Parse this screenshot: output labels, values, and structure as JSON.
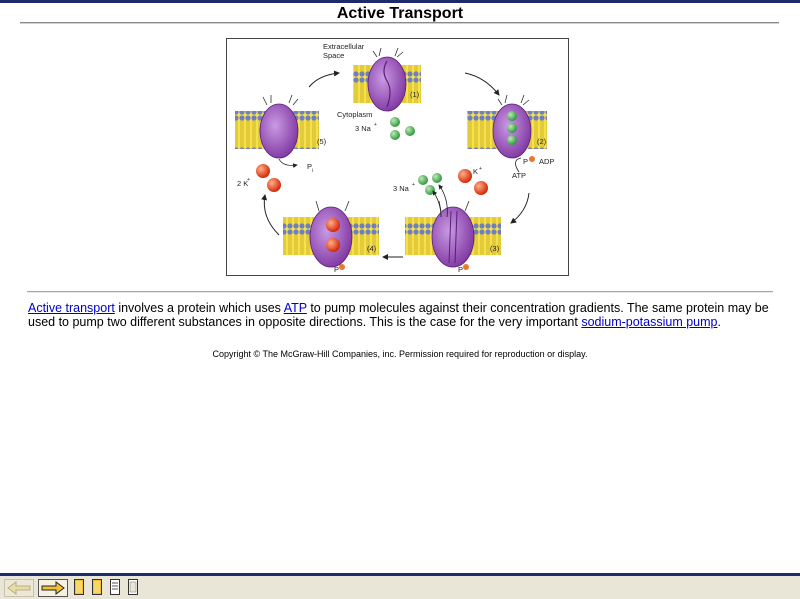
{
  "page": {
    "title": "Active Transport"
  },
  "figure": {
    "labels": {
      "extracellular_line1": "Extracellular",
      "extracellular_line2": "Space",
      "cytoplasm": "Cytoplasm",
      "step1_na": "3 Na",
      "adp": "ADP",
      "p_upper": "P",
      "atp": "ATP",
      "k_upper": "K",
      "step3_na": "3 Na",
      "p_step3": "P",
      "p_step4": "P",
      "two_k": "2 K",
      "pi": "P",
      "pi_sub": "i",
      "plus": "+"
    },
    "steps": [
      "(1)",
      "(2)",
      "(3)",
      "(4)",
      "(5)"
    ],
    "colors": {
      "protein": "#8a3fae",
      "protein_light": "#b77ad6",
      "membrane_yellow": "#f5e24a",
      "lipid_head": "#6f7fbf",
      "sodium": "#2f9a3f",
      "potassium": "#e23a12",
      "phosphate": "#e87a2a"
    }
  },
  "text": {
    "link_active_transport": "Active transport",
    "seg1": " involves a protein which uses ",
    "link_atp": "ATP",
    "seg2": " to pump molecules against their concentration gradients. The same protein may be used to pump two different substances in opposite directions. This is the case for the very important ",
    "link_sodium_potassium_pump": "sodium-potassium pump",
    "seg3": "."
  },
  "copyright": "Copyright © The McGraw-Hill Companies, inc. Permission required for reproduction or display.",
  "nav": {
    "icons": [
      "back-arrow-icon",
      "forward-arrow-icon",
      "page-icon",
      "page-icon",
      "document-icon",
      "page-icon"
    ]
  }
}
